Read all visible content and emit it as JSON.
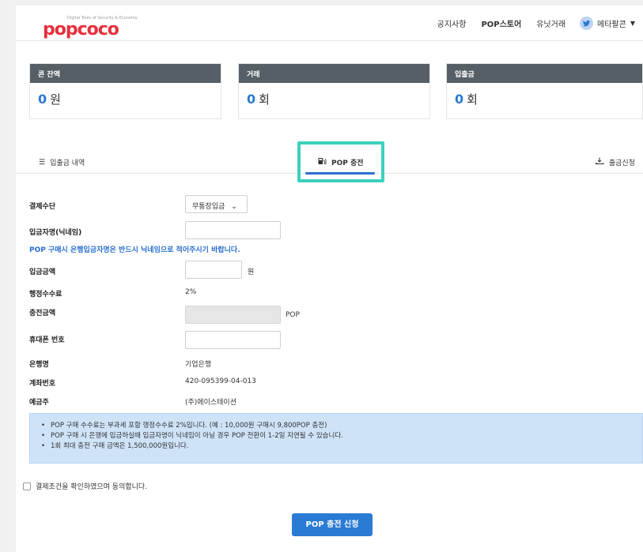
{
  "header": {
    "logo_text": "popcoco",
    "logo_tagline": "Digital Tools of Security & Economy",
    "nav": [
      "공지사항",
      "POP스토어",
      "유닛거래"
    ],
    "user_name": "메타팔콘"
  },
  "cards": [
    {
      "title": "콘 잔액",
      "value": "0",
      "unit": "원"
    },
    {
      "title": "거래",
      "value": "0",
      "unit": "회"
    },
    {
      "title": "입출금",
      "value": "0",
      "unit": "회"
    }
  ],
  "tabs": {
    "history": "입출금 내역",
    "charge": "POP 충전",
    "withdraw": "출금신청"
  },
  "form": {
    "payment_label": "결제수단",
    "payment_value": "무통장입금",
    "depositor_label": "입금자명(닉네임)",
    "depositor_value": "",
    "depositor_note": "POP 구매시 은행입금자명은 반드시 닉네임으로 적어주시기 바랍니다.",
    "amount_label": "입금금액",
    "amount_value": "",
    "amount_unit": "원",
    "fee_label": "행정수수료",
    "fee_value": "2%",
    "charge_label": "충전금액",
    "charge_value": "",
    "charge_unit": "POP",
    "phone_label": "휴대폰 번호",
    "phone_value": "",
    "bank_label": "은행명",
    "bank_value": "기업은행",
    "account_label": "계좌번호",
    "account_value": "420-095399-04-013",
    "holder_label": "예금주",
    "holder_value": "(주)에이스테이션"
  },
  "info": [
    "POP 구매 수수료는 부과세 포함 행정수수료 2%입니다. (예 : 10,000원 구매시 9,800POP 충전)",
    "POP 구매 시 은행에 입금하실때 입금자명이 닉네임이 아닐 경우 POP 전환이 1-2일 지연될 수 있습니다.",
    "1회 최대 충전 구매 금액은 1,500,000원입니다."
  ],
  "agree_label": "결제조건을 확인하였으며 동의합니다.",
  "submit_label": "POP 충전 신청",
  "colors": {
    "brand": "#e6303c",
    "accent": "#2a7bd3",
    "highlight": "#3dd0bc",
    "card_head": "#565f66",
    "info_bg": "#cfe3f8"
  }
}
